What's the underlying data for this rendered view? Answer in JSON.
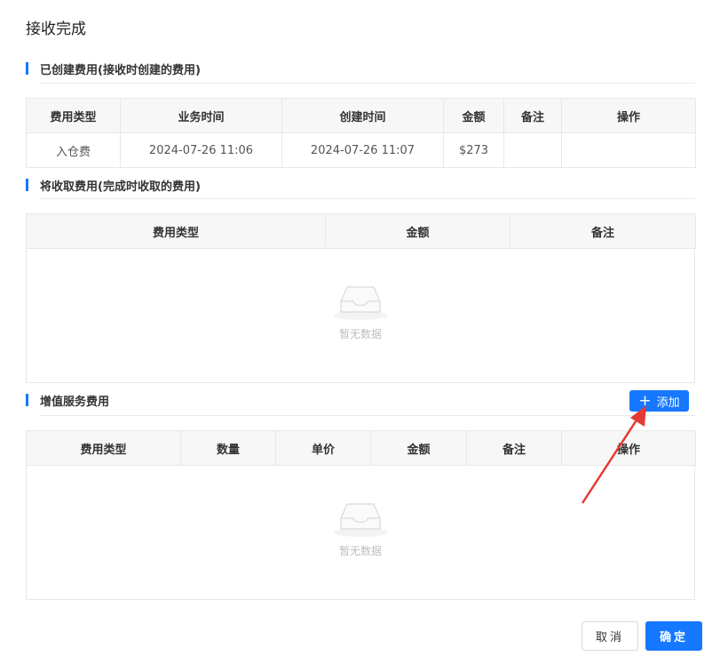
{
  "dialog": {
    "title": "接收完成"
  },
  "section_created": {
    "title": "已创建费用(接收时创建的费用)",
    "columns": [
      "费用类型",
      "业务时间",
      "创建时间",
      "金额",
      "备注",
      "操作"
    ],
    "rows": [
      [
        "入仓费",
        "2024-07-26 11:06",
        "2024-07-26 11:07",
        "$273",
        "",
        ""
      ]
    ]
  },
  "section_collect": {
    "title": "将收取费用(完成时收取的费用)",
    "columns": [
      "费用类型",
      "金额",
      "备注"
    ],
    "empty_text": "暂无数据"
  },
  "section_value_added": {
    "title": "增值服务费用",
    "add_button": {
      "icon": "plus-icon",
      "label": "添加"
    },
    "columns": [
      "费用类型",
      "数量",
      "单价",
      "金额",
      "备注",
      "操作"
    ],
    "empty_text": "暂无数据"
  },
  "footer": {
    "cancel_label": "取消",
    "ok_label": "确定"
  },
  "colors": {
    "accent": "#1677ff",
    "annotation_arrow": "#e53935"
  }
}
